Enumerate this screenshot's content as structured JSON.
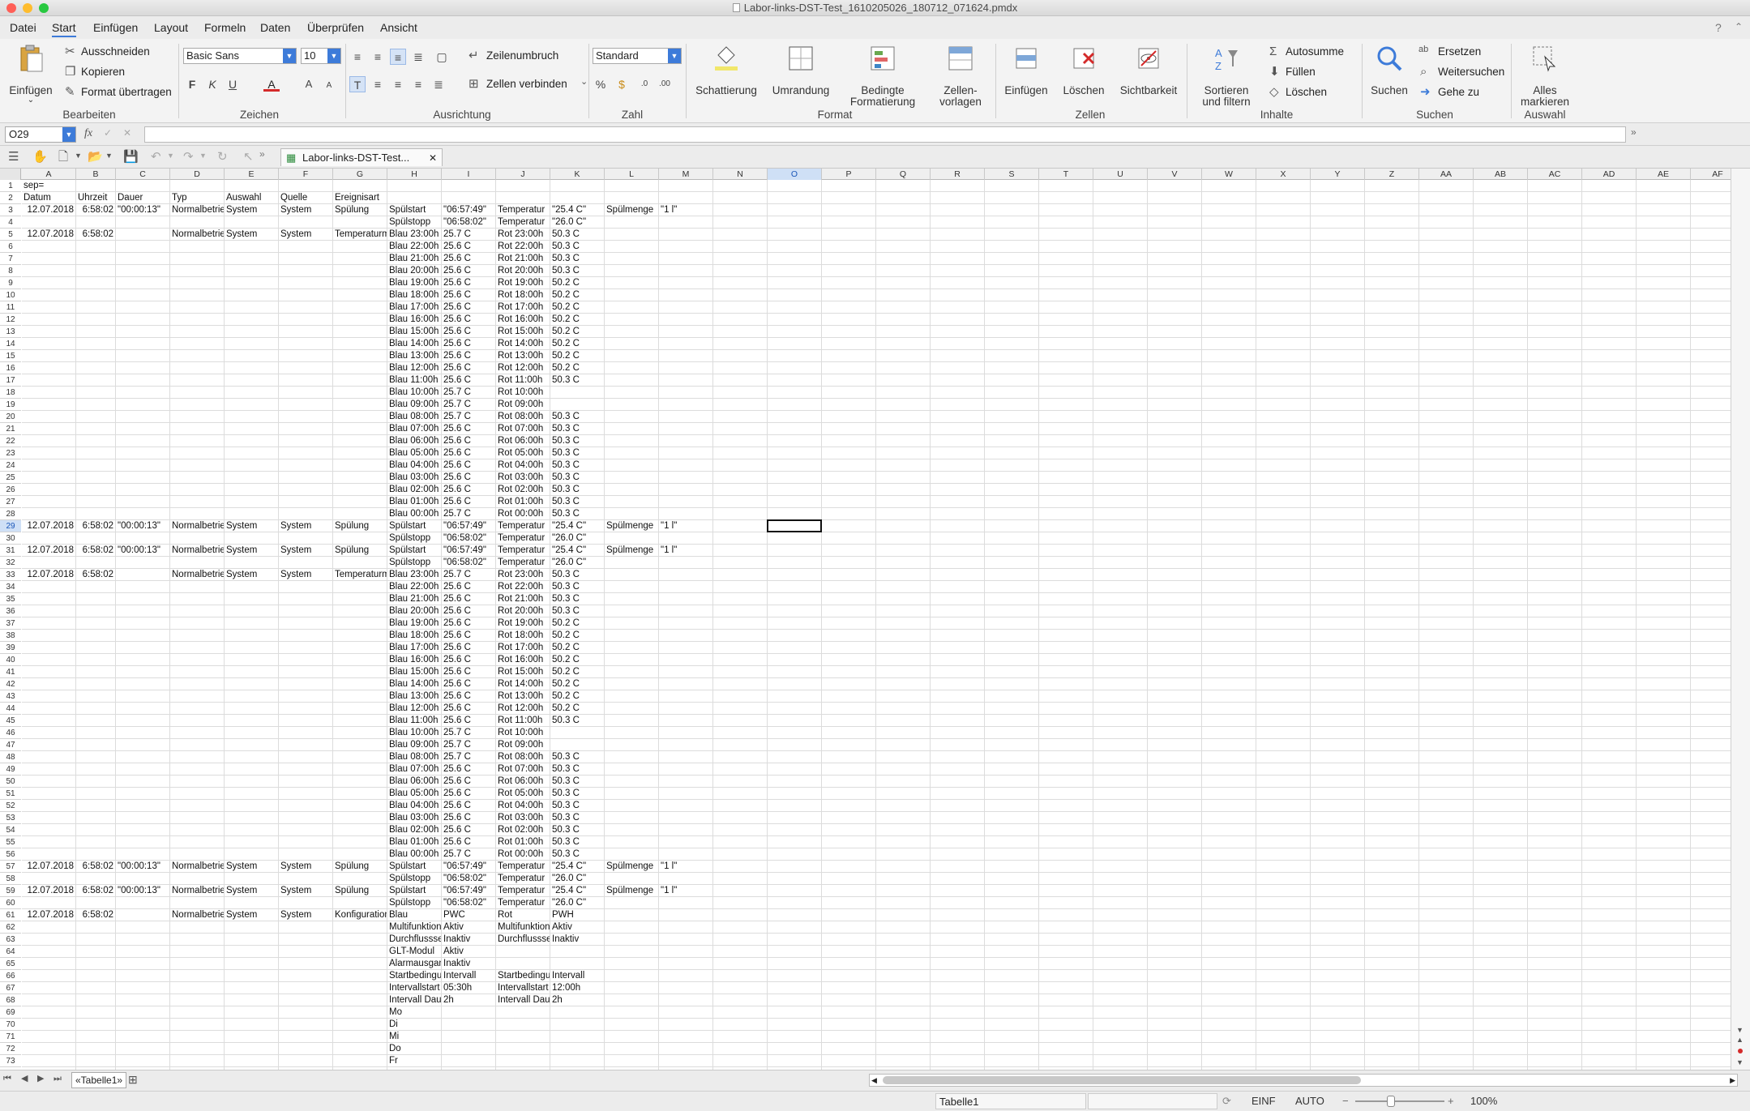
{
  "window": {
    "title": "Labor-links-DST-Test_1610205026_180712_071624.pmdx"
  },
  "menu": [
    "Datei",
    "Start",
    "Einfügen",
    "Layout",
    "Formeln",
    "Daten",
    "Überprüfen",
    "Ansicht"
  ],
  "help_icon": "?",
  "ribbon": {
    "einfuegen": "Einfügen",
    "ausschneiden": "Ausschneiden",
    "kopieren": "Kopieren",
    "format_uebertragen": "Format übertragen",
    "group_bearbeiten": "Bearbeiten",
    "font_name": "Basic Sans",
    "font_size": "10",
    "bold": "F",
    "italic": "K",
    "underline": "U",
    "font_color_letter": "A",
    "grow": "A",
    "shrink": "A",
    "group_zeichen": "Zeichen",
    "zeilenumbruch": "Zeilenumbruch",
    "zellen_verbinden": "Zellen verbinden",
    "group_ausrichtung": "Ausrichtung",
    "number_format": "Standard",
    "percent": "%",
    "group_zahl": "Zahl",
    "schattierung": "Schattierung",
    "umrandung": "Umrandung",
    "bedingte_1": "Bedingte",
    "bedingte_2": "Formatierung",
    "zellenvorlagen_1": "Zellen-",
    "zellenvorlagen_2": "vorlagen",
    "group_format": "Format",
    "z_einfuegen": "Einfügen",
    "z_loeschen": "Löschen",
    "sichtbarkeit": "Sichtbarkeit",
    "group_zellen": "Zellen",
    "sortieren_1": "Sortieren",
    "sortieren_2": "und filtern",
    "autosumme": "Autosumme",
    "fuellen": "Füllen",
    "i_loeschen": "Löschen",
    "group_inhalte": "Inhalte",
    "suchen": "Suchen",
    "ersetzen": "Ersetzen",
    "weitersuchen": "Weitersuchen",
    "gehe_zu": "Gehe zu",
    "group_suchen": "Suchen",
    "alles_1": "Alles",
    "alles_2": "markieren",
    "group_auswahl": "Auswahl"
  },
  "formula": {
    "cell_ref": "O29",
    "fx": "fx",
    "value": ""
  },
  "doc_tab": "Labor-links-DST-Test...",
  "columns": [
    "A",
    "B",
    "C",
    "D",
    "E",
    "F",
    "G",
    "H",
    "I",
    "J",
    "K",
    "L",
    "M",
    "N",
    "O",
    "P",
    "Q",
    "R",
    "S",
    "T",
    "U",
    "V",
    "W",
    "X",
    "Y",
    "Z",
    "AA",
    "AB",
    "AC",
    "AD",
    "AE",
    "AF"
  ],
  "selected_cell": "O29",
  "rows": [
    {
      "n": 1,
      "cells": {
        "A": "sep="
      }
    },
    {
      "n": 2,
      "cells": {
        "A": "Datum",
        "B": "Uhrzeit",
        "C": "Dauer",
        "D": "Typ",
        "E": "Auswahl",
        "F": "Quelle",
        "G": "Ereignisart"
      }
    },
    {
      "n": 3,
      "cells": {
        "A": "12.07.2018",
        "B": "6:58:02",
        "C": "\"00:00:13\"",
        "D": "Normalbetrieb",
        "E": "System",
        "F": "System",
        "G": "Spülung",
        "H": "Spülstart",
        "I": "\"06:57:49\"",
        "J": "Temperatur",
        "K": "\"25.4 C\"",
        "L": "Spülmenge",
        "M": "\"1 l\""
      }
    },
    {
      "n": 4,
      "cells": {
        "H": "Spülstopp",
        "I": "\"06:58:02\"",
        "J": "Temperatur",
        "K": "\"26.0 C\""
      }
    },
    {
      "n": 5,
      "cells": {
        "A": "12.07.2018",
        "B": "6:58:02",
        "D": "Normalbetrieb",
        "E": "System",
        "F": "System",
        "G": "Temperaturmessung",
        "H": "Blau 23:00h",
        "I": "25.7 C",
        "J": "Rot 23:00h",
        "K": "50.3 C"
      }
    },
    {
      "n": 6,
      "cells": {
        "H": "Blau 22:00h",
        "I": "25.6 C",
        "J": "Rot 22:00h",
        "K": "50.3 C"
      }
    },
    {
      "n": 7,
      "cells": {
        "H": "Blau 21:00h",
        "I": "25.6 C",
        "J": "Rot 21:00h",
        "K": "50.3 C"
      }
    },
    {
      "n": 8,
      "cells": {
        "H": "Blau 20:00h",
        "I": "25.6 C",
        "J": "Rot 20:00h",
        "K": "50.3 C"
      }
    },
    {
      "n": 9,
      "cells": {
        "H": "Blau 19:00h",
        "I": "25.6 C",
        "J": "Rot 19:00h",
        "K": "50.2 C"
      }
    },
    {
      "n": 10,
      "cells": {
        "H": "Blau 18:00h",
        "I": "25.6 C",
        "J": "Rot 18:00h",
        "K": "50.2 C"
      }
    },
    {
      "n": 11,
      "cells": {
        "H": "Blau 17:00h",
        "I": "25.6 C",
        "J": "Rot 17:00h",
        "K": "50.2 C"
      }
    },
    {
      "n": 12,
      "cells": {
        "H": "Blau 16:00h",
        "I": "25.6 C",
        "J": "Rot 16:00h",
        "K": "50.2 C"
      }
    },
    {
      "n": 13,
      "cells": {
        "H": "Blau 15:00h",
        "I": "25.6 C",
        "J": "Rot 15:00h",
        "K": "50.2 C"
      }
    },
    {
      "n": 14,
      "cells": {
        "H": "Blau 14:00h",
        "I": "25.6 C",
        "J": "Rot 14:00h",
        "K": "50.2 C"
      }
    },
    {
      "n": 15,
      "cells": {
        "H": "Blau 13:00h",
        "I": "25.6 C",
        "J": "Rot 13:00h",
        "K": "50.2 C"
      }
    },
    {
      "n": 16,
      "cells": {
        "H": "Blau 12:00h",
        "I": "25.6 C",
        "J": "Rot 12:00h",
        "K": "50.2 C"
      }
    },
    {
      "n": 17,
      "cells": {
        "H": "Blau 11:00h",
        "I": "25.6 C",
        "J": "Rot 11:00h",
        "K": "50.3 C"
      }
    },
    {
      "n": 18,
      "cells": {
        "H": "Blau 10:00h",
        "I": "25.7 C",
        "J": "Rot 10:00h"
      }
    },
    {
      "n": 19,
      "cells": {
        "H": "Blau 09:00h",
        "I": "25.7 C",
        "J": "Rot 09:00h"
      }
    },
    {
      "n": 20,
      "cells": {
        "H": "Blau 08:00h",
        "I": "25.7 C",
        "J": "Rot 08:00h",
        "K": "50.3 C"
      }
    },
    {
      "n": 21,
      "cells": {
        "H": "Blau 07:00h",
        "I": "25.6 C",
        "J": "Rot 07:00h",
        "K": "50.3 C"
      }
    },
    {
      "n": 22,
      "cells": {
        "H": "Blau 06:00h",
        "I": "25.6 C",
        "J": "Rot 06:00h",
        "K": "50.3 C"
      }
    },
    {
      "n": 23,
      "cells": {
        "H": "Blau 05:00h",
        "I": "25.6 C",
        "J": "Rot 05:00h",
        "K": "50.3 C"
      }
    },
    {
      "n": 24,
      "cells": {
        "H": "Blau 04:00h",
        "I": "25.6 C",
        "J": "Rot 04:00h",
        "K": "50.3 C"
      }
    },
    {
      "n": 25,
      "cells": {
        "H": "Blau 03:00h",
        "I": "25.6 C",
        "J": "Rot 03:00h",
        "K": "50.3 C"
      }
    },
    {
      "n": 26,
      "cells": {
        "H": "Blau 02:00h",
        "I": "25.6 C",
        "J": "Rot 02:00h",
        "K": "50.3 C"
      }
    },
    {
      "n": 27,
      "cells": {
        "H": "Blau 01:00h",
        "I": "25.6 C",
        "J": "Rot 01:00h",
        "K": "50.3 C"
      }
    },
    {
      "n": 28,
      "cells": {
        "H": "Blau 00:00h",
        "I": "25.7 C",
        "J": "Rot 00:00h",
        "K": "50.3 C"
      }
    },
    {
      "n": 29,
      "cells": {
        "A": "12.07.2018",
        "B": "6:58:02",
        "C": "\"00:00:13\"",
        "D": "Normalbetrieb",
        "E": "System",
        "F": "System",
        "G": "Spülung",
        "H": "Spülstart",
        "I": "\"06:57:49\"",
        "J": "Temperatur",
        "K": "\"25.4 C\"",
        "L": "Spülmenge",
        "M": "\"1 l\""
      }
    },
    {
      "n": 30,
      "cells": {
        "H": "Spülstopp",
        "I": "\"06:58:02\"",
        "J": "Temperatur",
        "K": "\"26.0 C\""
      }
    },
    {
      "n": 31,
      "cells": {
        "A": "12.07.2018",
        "B": "6:58:02",
        "C": "\"00:00:13\"",
        "D": "Normalbetrieb",
        "E": "System",
        "F": "System",
        "G": "Spülung",
        "H": "Spülstart",
        "I": "\"06:57:49\"",
        "J": "Temperatur",
        "K": "\"25.4 C\"",
        "L": "Spülmenge",
        "M": "\"1 l\""
      }
    },
    {
      "n": 32,
      "cells": {
        "H": "Spülstopp",
        "I": "\"06:58:02\"",
        "J": "Temperatur",
        "K": "\"26.0 C\""
      }
    },
    {
      "n": 33,
      "cells": {
        "A": "12.07.2018",
        "B": "6:58:02",
        "D": "Normalbetrieb",
        "E": "System",
        "F": "System",
        "G": "Temperaturmessung",
        "H": "Blau 23:00h",
        "I": "25.7 C",
        "J": "Rot 23:00h",
        "K": "50.3 C"
      }
    },
    {
      "n": 34,
      "cells": {
        "H": "Blau 22:00h",
        "I": "25.6 C",
        "J": "Rot 22:00h",
        "K": "50.3 C"
      }
    },
    {
      "n": 35,
      "cells": {
        "H": "Blau 21:00h",
        "I": "25.6 C",
        "J": "Rot 21:00h",
        "K": "50.3 C"
      }
    },
    {
      "n": 36,
      "cells": {
        "H": "Blau 20:00h",
        "I": "25.6 C",
        "J": "Rot 20:00h",
        "K": "50.3 C"
      }
    },
    {
      "n": 37,
      "cells": {
        "H": "Blau 19:00h",
        "I": "25.6 C",
        "J": "Rot 19:00h",
        "K": "50.2 C"
      }
    },
    {
      "n": 38,
      "cells": {
        "H": "Blau 18:00h",
        "I": "25.6 C",
        "J": "Rot 18:00h",
        "K": "50.2 C"
      }
    },
    {
      "n": 39,
      "cells": {
        "H": "Blau 17:00h",
        "I": "25.6 C",
        "J": "Rot 17:00h",
        "K": "50.2 C"
      }
    },
    {
      "n": 40,
      "cells": {
        "H": "Blau 16:00h",
        "I": "25.6 C",
        "J": "Rot 16:00h",
        "K": "50.2 C"
      }
    },
    {
      "n": 41,
      "cells": {
        "H": "Blau 15:00h",
        "I": "25.6 C",
        "J": "Rot 15:00h",
        "K": "50.2 C"
      }
    },
    {
      "n": 42,
      "cells": {
        "H": "Blau 14:00h",
        "I": "25.6 C",
        "J": "Rot 14:00h",
        "K": "50.2 C"
      }
    },
    {
      "n": 43,
      "cells": {
        "H": "Blau 13:00h",
        "I": "25.6 C",
        "J": "Rot 13:00h",
        "K": "50.2 C"
      }
    },
    {
      "n": 44,
      "cells": {
        "H": "Blau 12:00h",
        "I": "25.6 C",
        "J": "Rot 12:00h",
        "K": "50.2 C"
      }
    },
    {
      "n": 45,
      "cells": {
        "H": "Blau 11:00h",
        "I": "25.6 C",
        "J": "Rot 11:00h",
        "K": "50.3 C"
      }
    },
    {
      "n": 46,
      "cells": {
        "H": "Blau 10:00h",
        "I": "25.7 C",
        "J": "Rot 10:00h"
      }
    },
    {
      "n": 47,
      "cells": {
        "H": "Blau 09:00h",
        "I": "25.7 C",
        "J": "Rot 09:00h"
      }
    },
    {
      "n": 48,
      "cells": {
        "H": "Blau 08:00h",
        "I": "25.7 C",
        "J": "Rot 08:00h",
        "K": "50.3 C"
      }
    },
    {
      "n": 49,
      "cells": {
        "H": "Blau 07:00h",
        "I": "25.6 C",
        "J": "Rot 07:00h",
        "K": "50.3 C"
      }
    },
    {
      "n": 50,
      "cells": {
        "H": "Blau 06:00h",
        "I": "25.6 C",
        "J": "Rot 06:00h",
        "K": "50.3 C"
      }
    },
    {
      "n": 51,
      "cells": {
        "H": "Blau 05:00h",
        "I": "25.6 C",
        "J": "Rot 05:00h",
        "K": "50.3 C"
      }
    },
    {
      "n": 52,
      "cells": {
        "H": "Blau 04:00h",
        "I": "25.6 C",
        "J": "Rot 04:00h",
        "K": "50.3 C"
      }
    },
    {
      "n": 53,
      "cells": {
        "H": "Blau 03:00h",
        "I": "25.6 C",
        "J": "Rot 03:00h",
        "K": "50.3 C"
      }
    },
    {
      "n": 54,
      "cells": {
        "H": "Blau 02:00h",
        "I": "25.6 C",
        "J": "Rot 02:00h",
        "K": "50.3 C"
      }
    },
    {
      "n": 55,
      "cells": {
        "H": "Blau 01:00h",
        "I": "25.6 C",
        "J": "Rot 01:00h",
        "K": "50.3 C"
      }
    },
    {
      "n": 56,
      "cells": {
        "H": "Blau 00:00h",
        "I": "25.7 C",
        "J": "Rot 00:00h",
        "K": "50.3 C"
      }
    },
    {
      "n": 57,
      "cells": {
        "A": "12.07.2018",
        "B": "6:58:02",
        "C": "\"00:00:13\"",
        "D": "Normalbetrieb",
        "E": "System",
        "F": "System",
        "G": "Spülung",
        "H": "Spülstart",
        "I": "\"06:57:49\"",
        "J": "Temperatur",
        "K": "\"25.4 C\"",
        "L": "Spülmenge",
        "M": "\"1 l\""
      }
    },
    {
      "n": 58,
      "cells": {
        "H": "Spülstopp",
        "I": "\"06:58:02\"",
        "J": "Temperatur",
        "K": "\"26.0 C\""
      }
    },
    {
      "n": 59,
      "cells": {
        "A": "12.07.2018",
        "B": "6:58:02",
        "C": "\"00:00:13\"",
        "D": "Normalbetrieb",
        "E": "System",
        "F": "System",
        "G": "Spülung",
        "H": "Spülstart",
        "I": "\"06:57:49\"",
        "J": "Temperatur",
        "K": "\"25.4 C\"",
        "L": "Spülmenge",
        "M": "\"1 l\""
      }
    },
    {
      "n": 60,
      "cells": {
        "H": "Spülstopp",
        "I": "\"06:58:02\"",
        "J": "Temperatur",
        "K": "\"26.0 C\""
      }
    },
    {
      "n": 61,
      "cells": {
        "A": "12.07.2018",
        "B": "6:58:02",
        "D": "Normalbetrieb",
        "E": "System",
        "F": "System",
        "G": "Konfiguration",
        "H": "Blau",
        "I": "PWC",
        "J": "Rot",
        "K": "PWH"
      }
    },
    {
      "n": 62,
      "cells": {
        "H": "Multifunktion",
        "I": "Aktiv",
        "J": "Multifunktion",
        "K": "Aktiv"
      }
    },
    {
      "n": 63,
      "cells": {
        "H": "Durchflusssensor",
        "I": "Inaktiv",
        "J": "Durchflusssensor",
        "K": "Inaktiv"
      }
    },
    {
      "n": 64,
      "cells": {
        "H": "GLT-Modul",
        "I": "Aktiv"
      }
    },
    {
      "n": 65,
      "cells": {
        "H": "Alarmausgang",
        "I": "Inaktiv"
      }
    },
    {
      "n": 66,
      "cells": {
        "H": "Startbedingung",
        "I": "Intervall",
        "J": "Startbedingung",
        "K": "Intervall"
      }
    },
    {
      "n": 67,
      "cells": {
        "H": "Intervallstart",
        "I": "05:30h",
        "J": "Intervallstart",
        "K": "12:00h"
      }
    },
    {
      "n": 68,
      "cells": {
        "H": "Intervall Dauer",
        "I": "2h",
        "J": "Intervall Dauer",
        "K": "2h"
      }
    },
    {
      "n": 69,
      "cells": {
        "H": "Mo"
      }
    },
    {
      "n": 70,
      "cells": {
        "H": "Di"
      }
    },
    {
      "n": 71,
      "cells": {
        "H": "Mi"
      }
    },
    {
      "n": 72,
      "cells": {
        "H": "Do"
      }
    },
    {
      "n": 73,
      "cells": {
        "H": "Fr"
      }
    }
  ],
  "sheet_tab": "«Tabelle1»",
  "status": {
    "sheet_name": "Tabelle1",
    "mode1": "EINF",
    "mode2": "AUTO",
    "zoom": "100%",
    "zoom_level": 1.0
  },
  "colors": {
    "accent": "#3d7bd9",
    "selection": "#cfe0f6",
    "close_btn": "#ff5f57",
    "min_btn": "#febc2e",
    "max_btn": "#28c840"
  }
}
